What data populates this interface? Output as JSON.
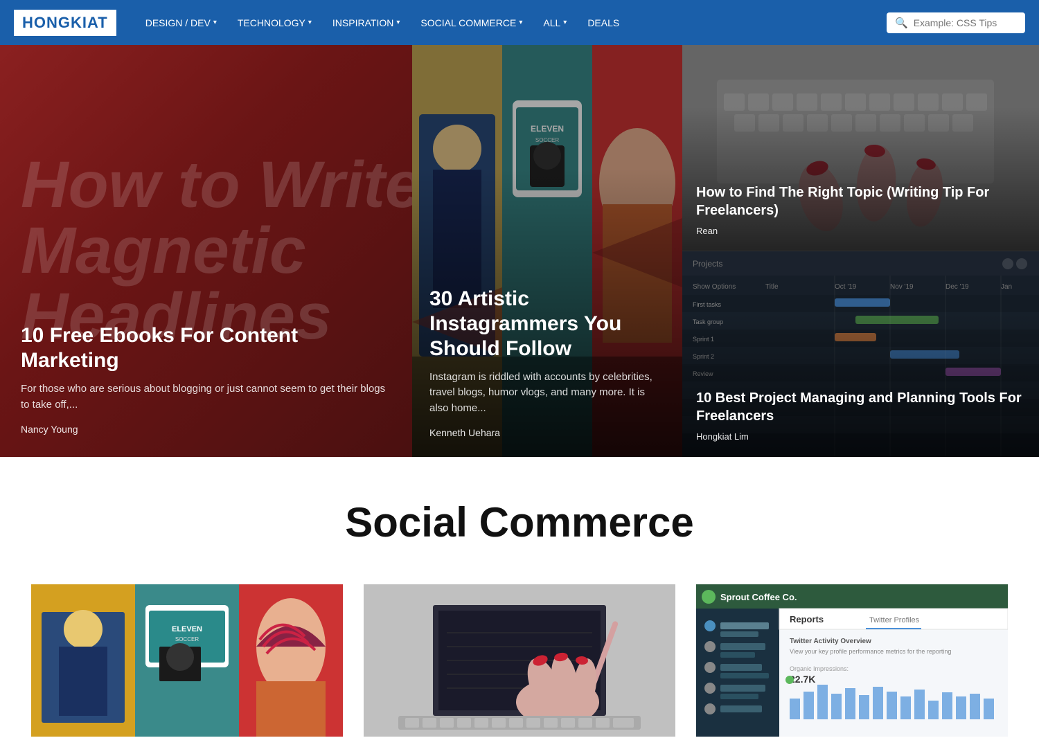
{
  "nav": {
    "logo": "HONGKIAT",
    "items": [
      {
        "label": "DESIGN / DEV",
        "hasDropdown": true
      },
      {
        "label": "TECHNOLOGY",
        "hasDropdown": true
      },
      {
        "label": "INSPIRATION",
        "hasDropdown": true
      },
      {
        "label": "SOCIAL COMMERCE",
        "hasDropdown": true
      },
      {
        "label": "ALL",
        "hasDropdown": true
      },
      {
        "label": "DEALS",
        "hasDropdown": false
      }
    ],
    "search_placeholder": "Example: CSS Tips"
  },
  "hero": {
    "card1": {
      "bg_text_line1": "How to Write",
      "bg_text_line2": "Magnetic",
      "bg_text_line3": "Headlines",
      "title": "10 Free Ebooks For Content Marketing",
      "excerpt": "For those who are serious about blogging or just cannot seem to get their blogs to take off,...",
      "author": "Nancy Young"
    },
    "card2": {
      "title": "30 Artistic Instagrammers You Should Follow",
      "excerpt": "Instagram is riddled with accounts by celebrities, travel blogs, humor vlogs, and many more. It is also home...",
      "author": "Kenneth Uehara"
    },
    "card3_top": {
      "title": "How to Find The Right Topic (Writing Tip For Freelancers)",
      "author": "Rean"
    },
    "card3_bottom": {
      "title": "10 Best Project Managing and Planning Tools For Freelancers",
      "author": "Hongkiat Lim"
    }
  },
  "section": {
    "title": "Social Commerce"
  },
  "bottom_cards": [
    {
      "label": "Artistic Instagrammers",
      "type": "artistic"
    },
    {
      "label": "Laptop Writing",
      "type": "laptop"
    },
    {
      "label": "Sprout Reports",
      "type": "sprout"
    }
  ]
}
